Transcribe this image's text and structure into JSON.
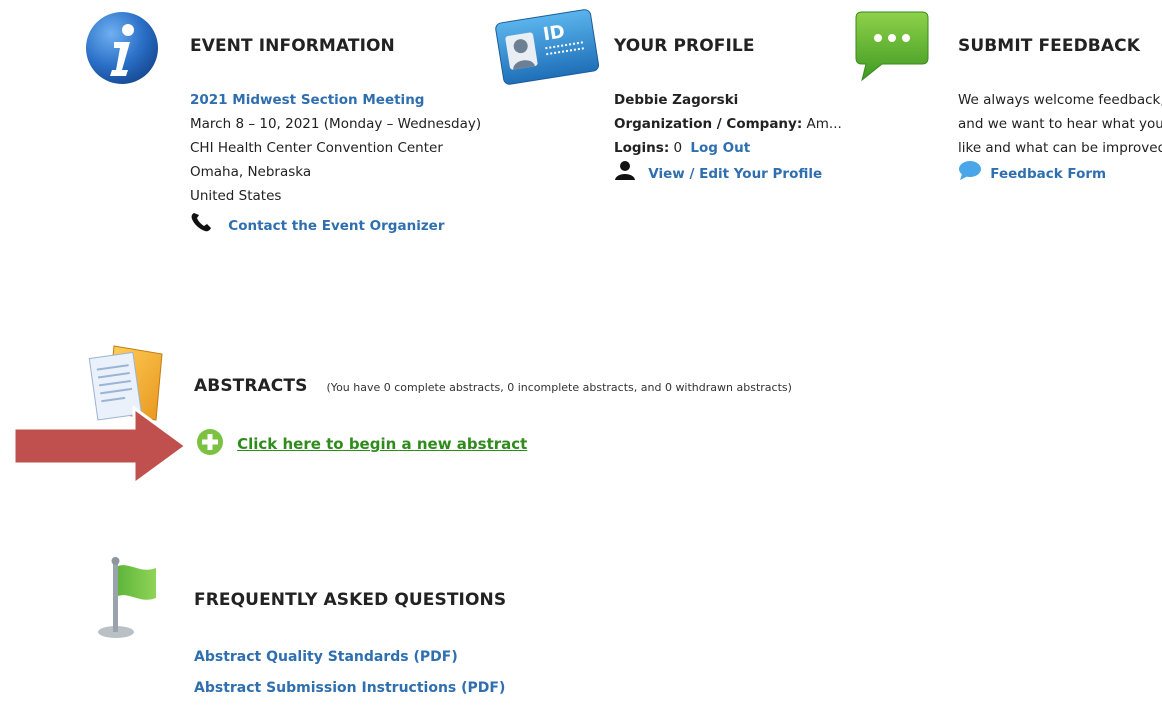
{
  "event": {
    "title": "EVENT INFORMATION",
    "name": "2021 Midwest Section Meeting",
    "dates": "March 8 – 10, 2021 (Monday – Wednesday)",
    "venue": "CHI Health Center Convention Center",
    "city": "Omaha, Nebraska",
    "country": "United States",
    "contact_link": "Contact the Event Organizer"
  },
  "profile": {
    "title": "YOUR PROFILE",
    "badge_text": "ID",
    "name": "Debbie Zagorski",
    "org_label": "Organization / Company:",
    "org_value": "Am...",
    "logins_label": "Logins:",
    "logins_value": "0",
    "logout_link": "Log Out",
    "edit_link": "View / Edit Your Profile"
  },
  "feedback": {
    "title": "SUBMIT FEEDBACK",
    "line1": "We always welcome feedback,",
    "line2": "and we want to hear what you",
    "line3": "like and what can be improved.",
    "form_link": "Feedback Form"
  },
  "abstracts": {
    "title": "ABSTRACTS",
    "summary": "(You have 0 complete abstracts, 0 incomplete abstracts, and 0 withdrawn abstracts)",
    "new_link": "Click here to begin a new abstract"
  },
  "faq": {
    "title": "FREQUENTLY ASKED QUESTIONS",
    "links": [
      "Abstract Quality Standards (PDF)",
      "Abstract Submission Instructions (PDF)"
    ]
  },
  "colors": {
    "link_blue": "#2f6fb0",
    "link_green": "#2e8b1c",
    "arrow_red": "#c0504d"
  }
}
